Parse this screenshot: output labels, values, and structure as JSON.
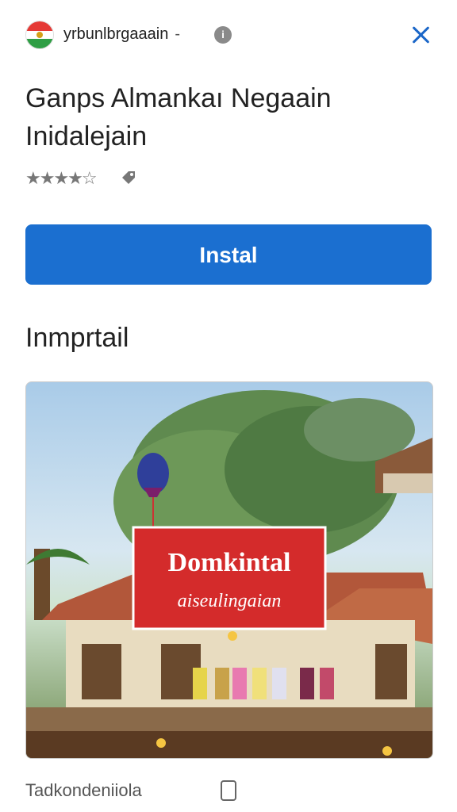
{
  "header": {
    "publisher": "yrbunlbrgaaain",
    "separator": "-",
    "info_glyph": "i"
  },
  "app": {
    "title_line1": "Ganps Almankaı Negaain",
    "title_line2": "Inidalejain",
    "rating_stars": "★★★★☆",
    "rating_value": 3.5
  },
  "install_button": {
    "label": "Instal"
  },
  "section": {
    "title": "Inmprtail"
  },
  "screenshot": {
    "sign_line1": "Domkintal",
    "sign_line2": "aiseulingaian"
  },
  "footer": {
    "label": "Tadkondeniiola"
  },
  "colors": {
    "accent": "#1b6fd0",
    "sign_red": "#d42b2b",
    "close_blue": "#1a66c8"
  }
}
